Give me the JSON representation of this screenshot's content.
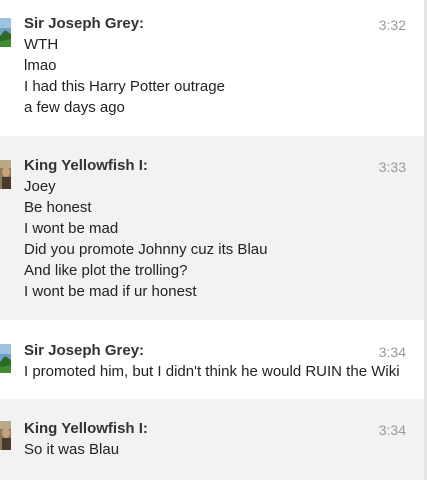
{
  "messages": [
    {
      "sender": "Sir Joseph Grey:",
      "time": "3:32",
      "lines": [
        "WTH",
        "lmao",
        "I had this Harry Potter outrage",
        "a few days ago"
      ]
    },
    {
      "sender": "King Yellowfish I:",
      "time": "3:33",
      "lines": [
        "Joey",
        "Be honest",
        "I wont be mad",
        "Did you promote Johnny cuz its Blau",
        "And like plot the trolling?",
        "I wont be mad if ur honest"
      ]
    },
    {
      "sender": "Sir Joseph Grey:",
      "time": "3:34",
      "lines": [
        "I promoted him, but I didn't think he would RUIN the Wiki"
      ]
    },
    {
      "sender": "King Yellowfish I:",
      "time": "3:34",
      "lines": [
        "So it was Blau"
      ]
    }
  ],
  "colors": {
    "alt_background": "#f2f2f2",
    "timestamp": "#999999",
    "sender": "#333333"
  }
}
